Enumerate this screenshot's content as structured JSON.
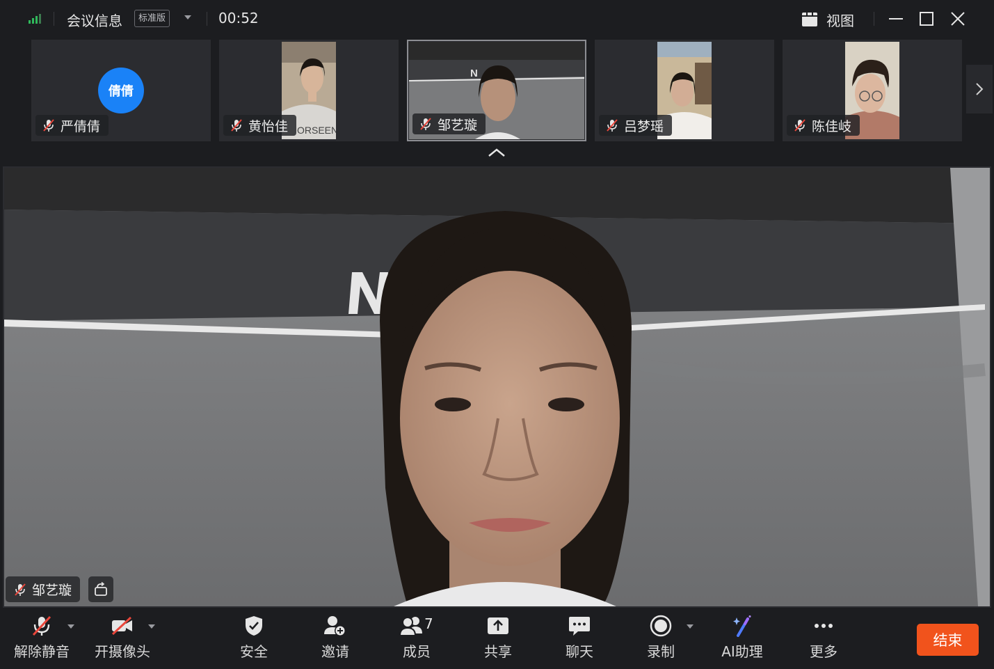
{
  "titlebar": {
    "meeting_info": "会议信息",
    "edition_badge": "标准版",
    "timer": "00:52",
    "view_label": "视图"
  },
  "participants": [
    {
      "name": "严倩倩",
      "avatar_text": "倩倩",
      "video": false,
      "muted": true
    },
    {
      "name": "黄怡佳",
      "video": true,
      "muted": true
    },
    {
      "name": "邹艺璇",
      "video": true,
      "muted": true,
      "active": true
    },
    {
      "name": "吕梦瑶",
      "video": true,
      "muted": true
    },
    {
      "name": "陈佳岐",
      "video": true,
      "muted": true
    }
  ],
  "main_video": {
    "speaker_name": "邹艺璇",
    "muted": true
  },
  "toolbar": {
    "unmute": "解除静音",
    "start_video": "开摄像头",
    "security": "安全",
    "invite": "邀请",
    "members": "成员",
    "members_count": "7",
    "share": "共享",
    "chat": "聊天",
    "record": "录制",
    "ai_assistant": "AI助理",
    "more": "更多",
    "end": "结束"
  },
  "colors": {
    "background": "#1c1d20",
    "tile": "#2b2c30",
    "avatar": "#1a82f7",
    "end_button": "#f1531c",
    "signal": "#2fb95b",
    "muted_red": "#e9463b"
  },
  "icons": [
    "signal-icon",
    "chevron-down-icon",
    "view-grid-icon",
    "minimize-icon",
    "maximize-icon",
    "close-icon",
    "mic-muted-icon",
    "chevron-right-icon",
    "chevron-up-icon",
    "rotate-icon",
    "camera-off-icon",
    "shield-icon",
    "add-user-icon",
    "members-icon",
    "share-icon",
    "chat-icon",
    "record-icon",
    "ai-wand-icon",
    "more-icon"
  ]
}
